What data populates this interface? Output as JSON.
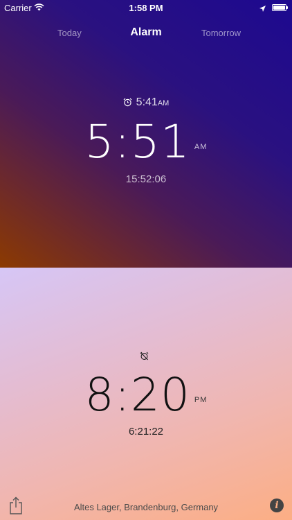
{
  "status_bar": {
    "carrier": "Carrier",
    "time": "1:58 PM",
    "icons": [
      "wifi-icon",
      "location-arrow-icon",
      "battery-icon"
    ]
  },
  "tabs": {
    "today": "Today",
    "alarm": "Alarm",
    "tomorrow": "Tomorrow"
  },
  "top_panel": {
    "alarm_time": "5:41",
    "alarm_ampm": "AM",
    "main_time": "5:51",
    "main_ampm": "AM",
    "countdown": "15:52:06",
    "icon": "alarm-clock-icon"
  },
  "bottom_panel": {
    "icon": "alarm-off-icon",
    "main_time": "8:20",
    "main_ampm": "PM",
    "countdown": "6:21:22"
  },
  "footer": {
    "location": "Altes Lager, Brandenburg, Germany",
    "share_icon": "share-icon",
    "info_icon": "info-icon",
    "info_glyph": "i"
  },
  "colors": {
    "top_gradient": [
      "#1d0990",
      "#8c3a00"
    ],
    "bottom_gradient": [
      "#d6c6f6",
      "#fcae84"
    ]
  }
}
